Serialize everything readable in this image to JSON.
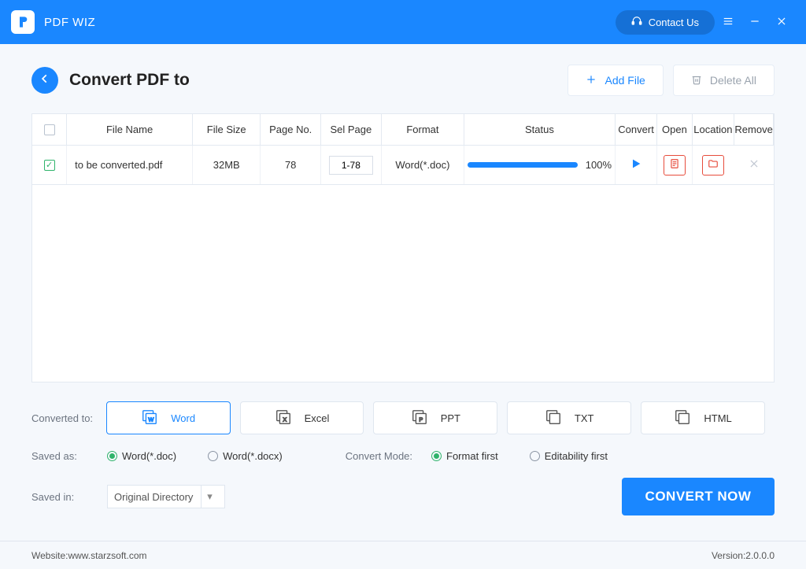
{
  "app": {
    "title": "PDF WIZ"
  },
  "titlebar": {
    "contact": "Contact Us"
  },
  "header": {
    "page_title": "Convert PDF to",
    "add_file": "Add File",
    "delete_all": "Delete All"
  },
  "table": {
    "headers": {
      "name": "File Name",
      "size": "File Size",
      "page_no": "Page No.",
      "sel_page": "Sel Page",
      "format": "Format",
      "status": "Status",
      "convert": "Convert",
      "open": "Open",
      "location": "Location",
      "remove": "Remove"
    },
    "rows": [
      {
        "checked": true,
        "name": "to be converted.pdf",
        "size": "32MB",
        "pages": "78",
        "sel": "1-78",
        "format": "Word(*.doc)",
        "progress_pct": 100,
        "progress_label": "100%"
      }
    ]
  },
  "formats": {
    "label": "Converted to:",
    "options": [
      "Word",
      "Excel",
      "PPT",
      "TXT",
      "HTML"
    ],
    "active": 0
  },
  "saved_as": {
    "label": "Saved as:",
    "options": [
      "Word(*.doc)",
      "Word(*.docx)"
    ],
    "selected": 0
  },
  "convert_mode": {
    "label": "Convert Mode:",
    "options": [
      "Format first",
      "Editability first"
    ],
    "selected": 0
  },
  "saved_in": {
    "label": "Saved in:",
    "value": "Original Directory"
  },
  "actions": {
    "convert_now": "CONVERT NOW"
  },
  "footer": {
    "website_label": "Website: ",
    "website_value": "www.starzsoft.com",
    "version_label": "Version: ",
    "version_value": "2.0.0.0"
  }
}
